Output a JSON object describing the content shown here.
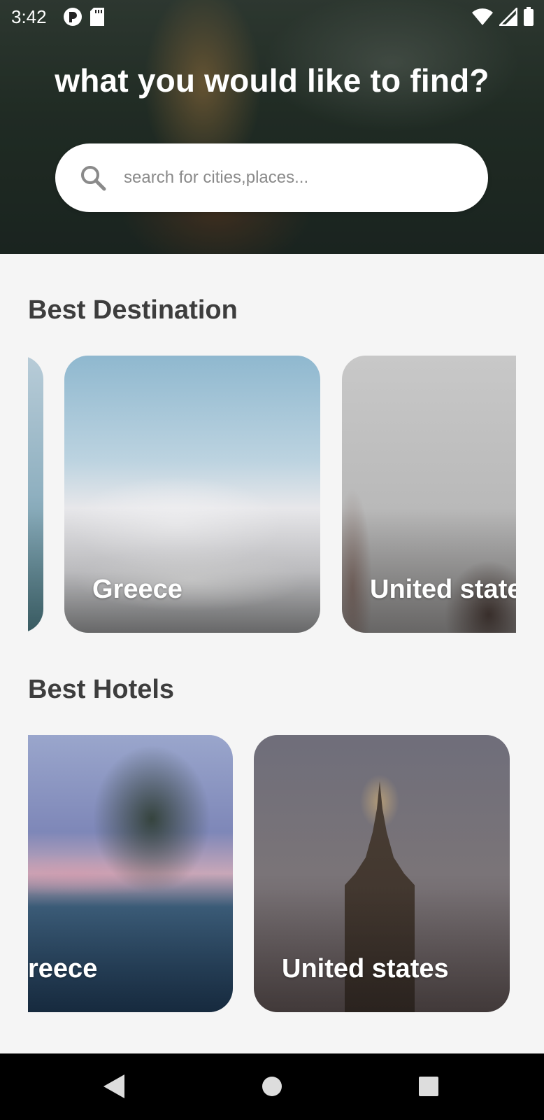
{
  "status_bar": {
    "time": "3:42",
    "left_icons": [
      "notification-app-icon",
      "sd-card-icon"
    ],
    "right_icons": [
      "wifi-icon",
      "signal-icon",
      "battery-icon"
    ]
  },
  "hero": {
    "title": "what you would like to find?",
    "search": {
      "placeholder": "search for cities,places...",
      "value": ""
    }
  },
  "destinations": {
    "title": "Best Destination",
    "items": [
      {
        "label": "",
        "image": "coastal-scene"
      },
      {
        "label": "Greece",
        "image": "santorini-white-houses"
      },
      {
        "label": "United state",
        "image": "foggy-bridge-travelers"
      }
    ]
  },
  "hotels": {
    "title": "Best Hotels",
    "items": [
      {
        "label": "reece",
        "image": "resort-pool-palms"
      },
      {
        "label": "United states",
        "image": "empire-state-building"
      }
    ]
  },
  "nav_bar": {
    "buttons": [
      "back-icon",
      "home-icon",
      "recents-icon"
    ]
  }
}
